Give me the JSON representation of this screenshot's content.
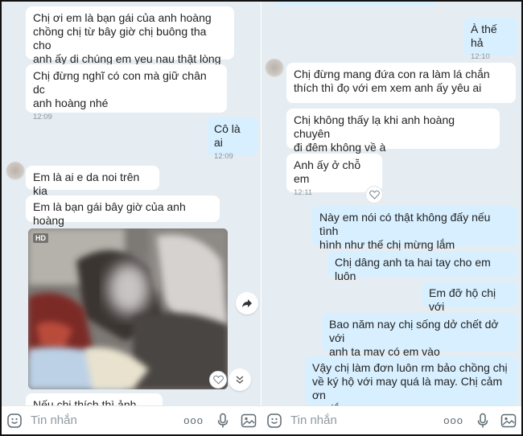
{
  "left": {
    "messages": [
      {
        "text": "Chị ơi em là bạn gái của anh hoàng\nchồng chị từ bây giờ chị buông tha cho\nanh ấy di chúng em yeu nau thật lòng",
        "time": ""
      },
      {
        "text": "Chị đừng nghĩ có con mà giữ chân dc\nanh hoàng nhé",
        "time": "12:09"
      },
      {
        "text": "Cô là ai",
        "time": "12:09"
      },
      {
        "text": "Em là ai e da noi trên kia",
        "time": ""
      },
      {
        "text": "Em là bạn gái bây giờ của anh hoàng",
        "time": ""
      },
      {
        "text": "Nếu chị thích thì ảnh đây",
        "time": ""
      }
    ],
    "photo": {
      "badge": "HD"
    }
  },
  "right": {
    "messages": [
      {
        "text": "À thế hả",
        "time": "12:10"
      },
      {
        "text": "Chị đừng mang đứa con ra làm lá chắn\nthích thì đọ với em xem anh ấy yêu ai",
        "time": ""
      },
      {
        "text": "Chị không thấy lạ khi anh hoàng chuyên\nđi đêm không về à",
        "time": ""
      },
      {
        "text": "Anh ấy ở chỗ em",
        "time": "12:11"
      },
      {
        "text": "Này em nói có thật không đấy nếu tình\nhình như thế chị mừng lắm",
        "time": ""
      },
      {
        "text": "Chị dâng anh ta hai tay cho em luôn",
        "time": ""
      },
      {
        "text": "Em đỡ hộ chị với",
        "time": ""
      },
      {
        "text": "Bao năm nay chị sống dở chết dở với\nanh ta may có em vào",
        "time": ""
      },
      {
        "text": "Vậy chị làm đơn luôn rm bảo chồng chị\nvề ký hộ với may quá là may. Chị cảm ơn\nem lắm",
        "time": ""
      }
    ]
  },
  "composer": {
    "placeholder": "Tin nhắn",
    "more": "ooo"
  },
  "icons": {
    "emoji": "smiley-icon",
    "mic": "microphone-icon",
    "image": "image-icon",
    "heart": "heart-icon",
    "share": "share-arrow-icon",
    "scroll": "double-chevron-down-icon"
  },
  "colors": {
    "background": "#e6edf2",
    "incoming": "#ffffff",
    "outgoing": "#d7efff",
    "time": "#8a949c"
  }
}
